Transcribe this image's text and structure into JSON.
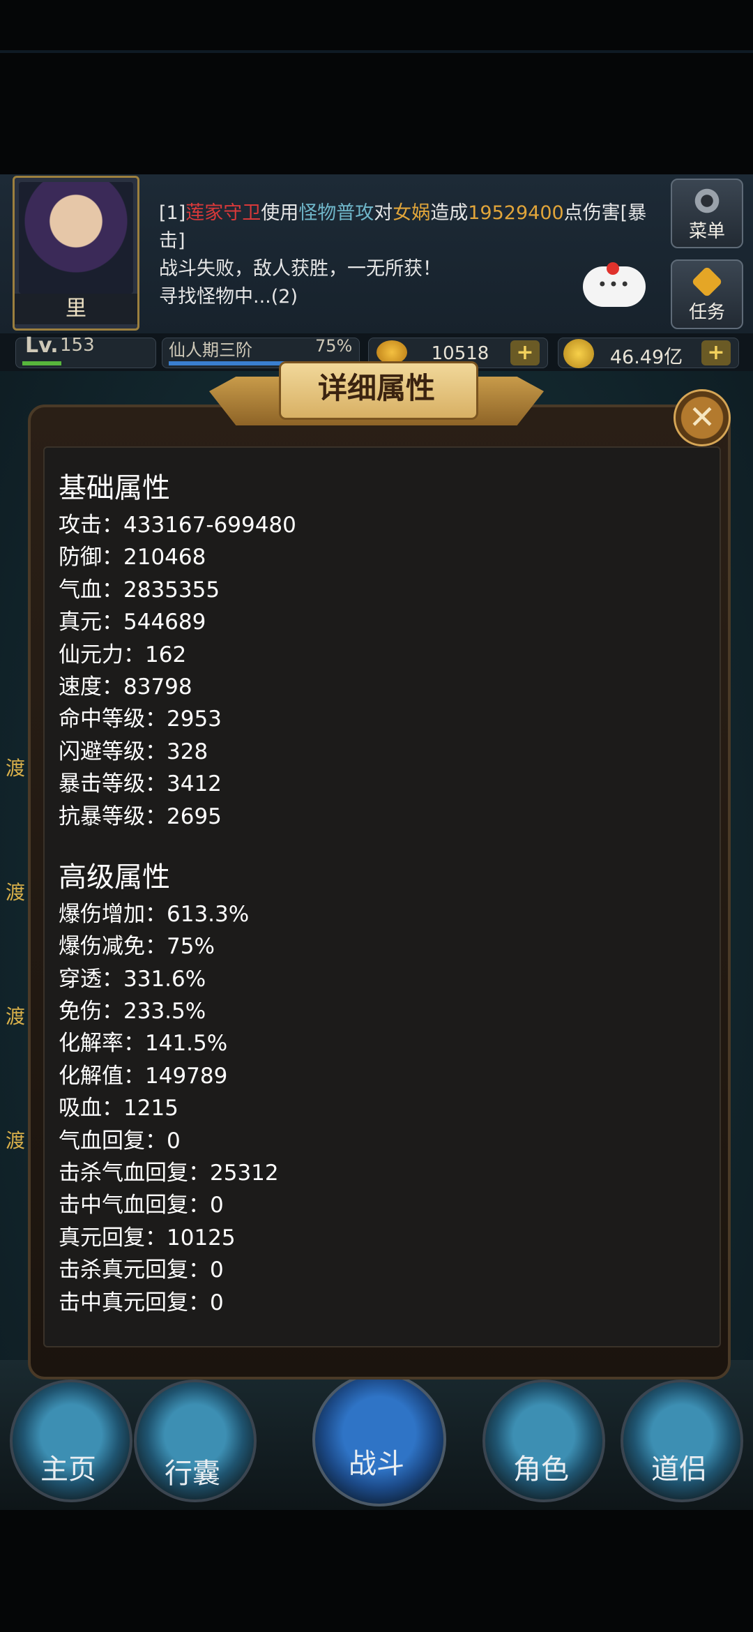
{
  "header": {
    "avatar_name": "里",
    "log_prefix": "[1]",
    "log_attacker": "莲家守卫",
    "log_use": "使用",
    "log_skill": "怪物普攻",
    "log_to": "对",
    "log_target": "女娲",
    "log_cause": "造成",
    "log_damage": "19529400",
    "log_tail": "点伤害[暴击]",
    "log_line2": "战斗失败，敌人获胜，一无所获！",
    "log_line3": "寻找怪物中...(2)",
    "menu_label": "菜单",
    "task_label": "任务",
    "bubble_dots": "•••"
  },
  "status": {
    "lv_label": "Lv.",
    "level": "153",
    "stage": "仙人期三阶",
    "stage_percent": "75%",
    "stage_progress": 0.75,
    "gems": "10518",
    "coins": "46.49亿",
    "plus": "+"
  },
  "side_labels": [
    "渡",
    "渡",
    "渡",
    "渡"
  ],
  "panel": {
    "title": "详细属性",
    "close": "✕",
    "basic_title": "基础属性",
    "basic": [
      "攻击：433167-699480",
      "防御：210468",
      "气血：2835355",
      "真元：544689",
      "仙元力：162",
      "速度：83798",
      "命中等级：2953",
      "闪避等级：328",
      "暴击等级：3412",
      "抗暴等级：2695"
    ],
    "advanced_title": "高级属性",
    "advanced": [
      "爆伤增加：613.3%",
      "爆伤减免：75%",
      "穿透：331.6%",
      "免伤：233.5%",
      "化解率：141.5%",
      "化解值：149789",
      "吸血：1215",
      "气血回复：0",
      "击杀气血回复：25312",
      "击中气血回复：0",
      "真元回复：10125",
      "击杀真元回复：0",
      "击中真元回复：0"
    ]
  },
  "nav": {
    "home": "主页",
    "bag": "行囊",
    "battle": "战斗",
    "role": "角色",
    "companion": "道侣"
  }
}
